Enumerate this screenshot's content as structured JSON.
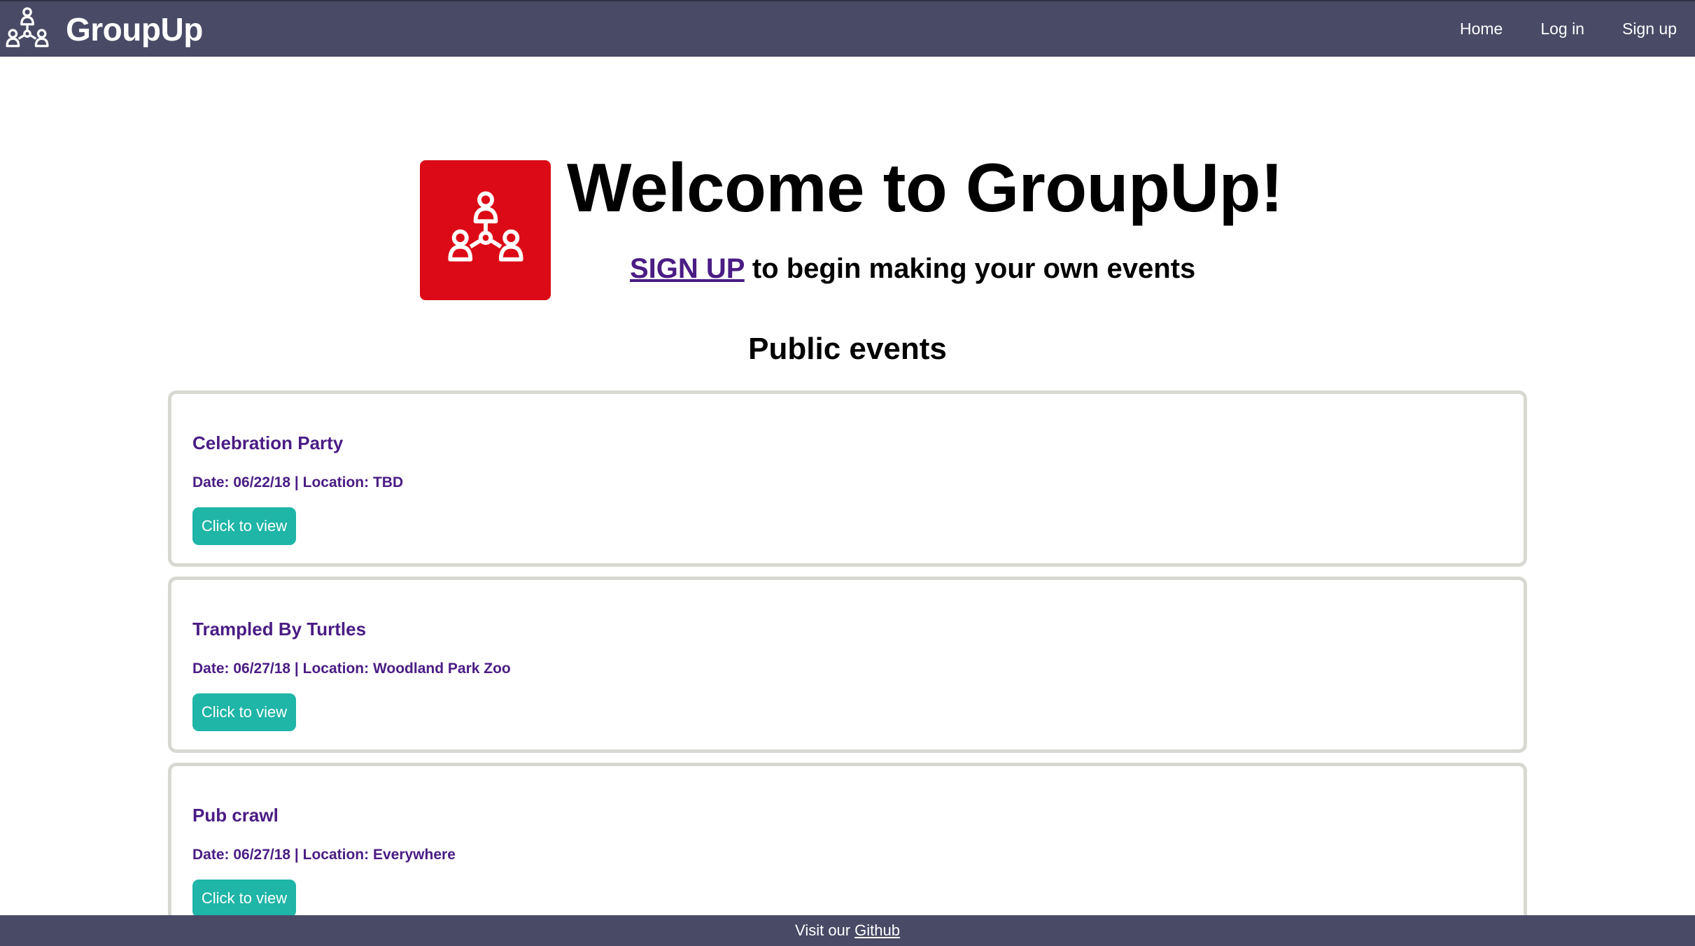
{
  "header": {
    "brand": "GroupUp",
    "nav": [
      {
        "label": "Home"
      },
      {
        "label": "Log in"
      },
      {
        "label": "Sign up"
      }
    ]
  },
  "hero": {
    "title": "Welcome to GroupUp!",
    "signup_link": "SIGN UP",
    "subtitle_rest": " to begin making your own events"
  },
  "events_section": {
    "title": "Public events",
    "button_label": "Click to view",
    "events": [
      {
        "title": "Celebration Party",
        "meta": "Date: 06/22/18 | Location: TBD"
      },
      {
        "title": "Trampled By Turtles",
        "meta": "Date: 06/27/18 | Location: Woodland Park Zoo"
      },
      {
        "title": "Pub crawl",
        "meta": "Date: 06/27/18 | Location: Everywhere"
      }
    ]
  },
  "footer": {
    "text": "Visit our",
    "link": "Github"
  },
  "colors": {
    "navbar": "#484a66",
    "logo_red": "#dc0a16",
    "event_text": "#4a1c84",
    "button_teal": "#1fb5a7"
  },
  "icons": {
    "brand": "group-network-icon",
    "hero": "group-network-icon"
  }
}
